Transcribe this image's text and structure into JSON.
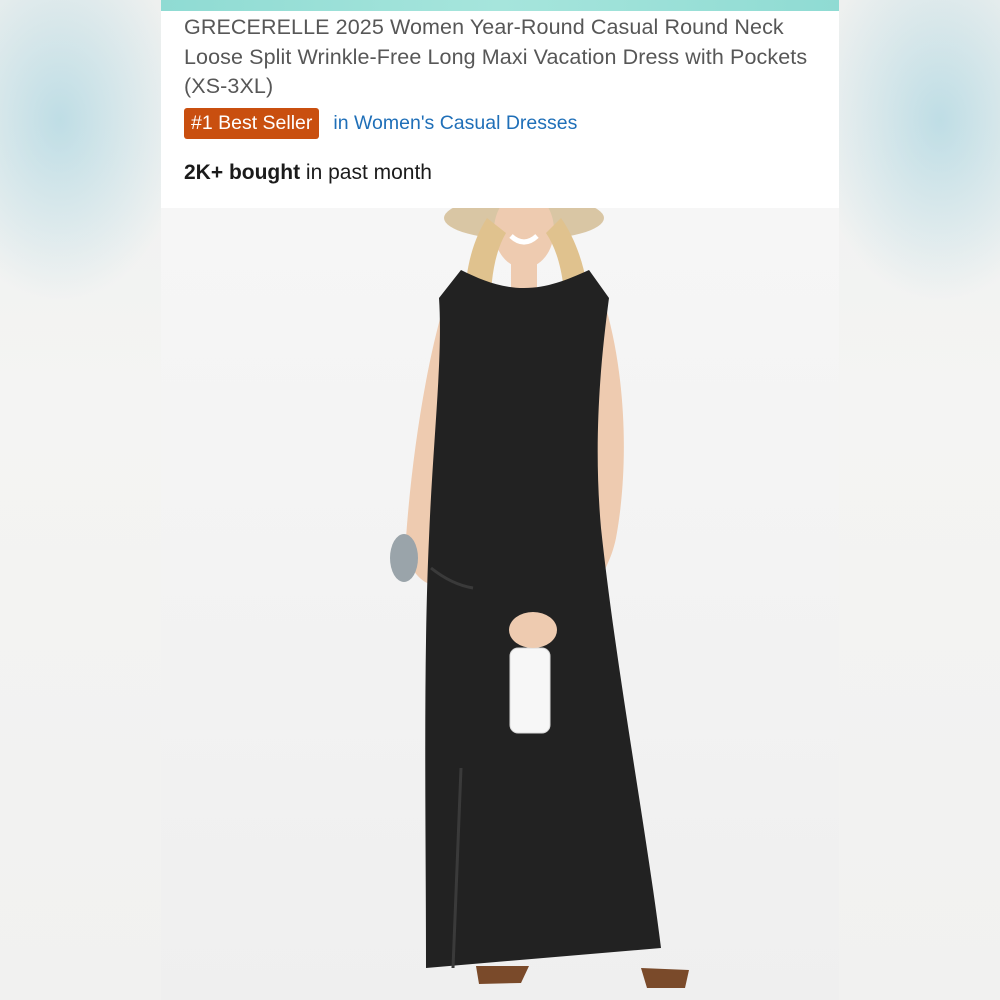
{
  "product": {
    "title": "GRECERELLE 2025 Women Year-Round Casual Round Neck Loose Split Wrinkle-Free Long Maxi Vacation Dress with Pockets (XS-3XL)",
    "badge": "#1 Best Seller",
    "category_link": "in Women's Casual Dresses",
    "bought_bold": "2K+ bought",
    "bought_rest": " in past month"
  },
  "colors": {
    "badge_bg": "#c94f0f",
    "link": "#1f6fb8",
    "accent": "#8fdbd3",
    "dress": "#222222"
  },
  "image": {
    "subject": "woman-in-black-maxi-dress-icon"
  }
}
